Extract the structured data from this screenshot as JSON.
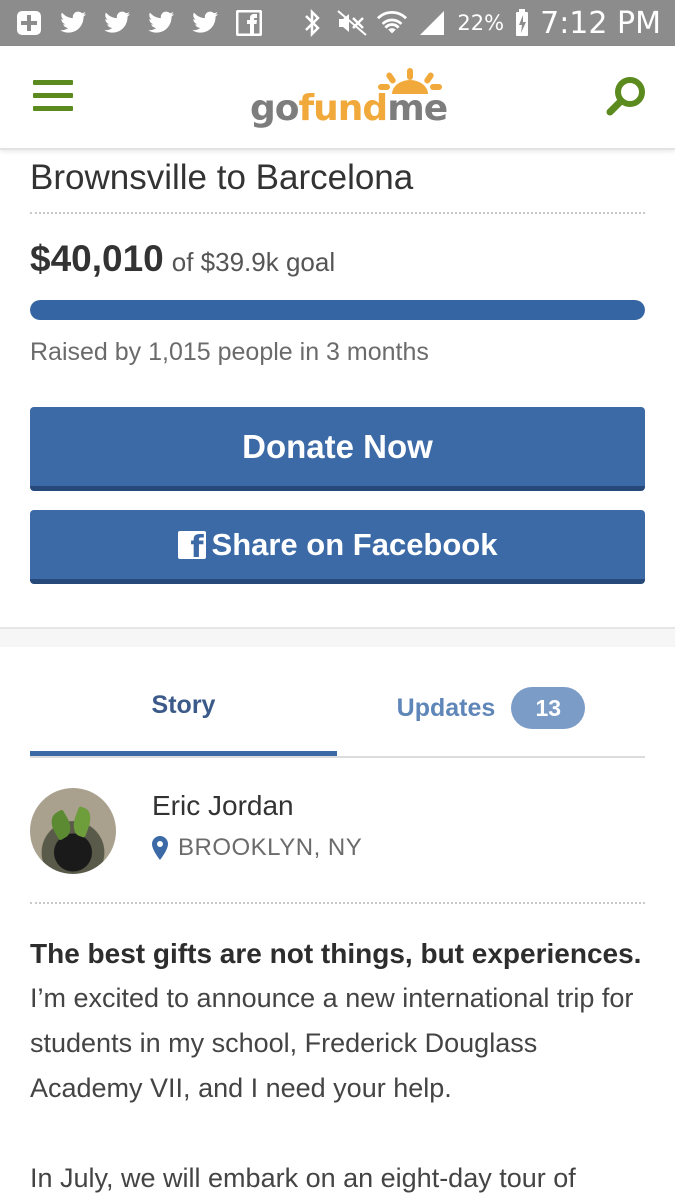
{
  "status_bar": {
    "battery": "22%",
    "time": "7:12 PM"
  },
  "header": {
    "logo": {
      "part1": "go",
      "part2": "fund",
      "part3": "me"
    }
  },
  "campaign": {
    "title": "Brownsville to Barcelona",
    "amount": "$40,010",
    "goal_text": "of $39.9k goal",
    "progress": 1.0,
    "raised_text": "Raised by 1,015 people in 3 months",
    "donate_label": "Donate Now",
    "share_label": "Share on Facebook"
  },
  "tabs": {
    "story": "Story",
    "updates": "Updates",
    "updates_count": "13"
  },
  "organizer": {
    "name": "Eric Jordan",
    "location": "BROOKLYN, NY"
  },
  "story": {
    "lead": "The best gifts are not things, but experiences.",
    "p1": "I’m excited to announce a new international trip for students in my school, Frederick Douglass Academy VII, and I need your help.",
    "p2": "In July, we will embark on an eight-day tour of"
  },
  "colors": {
    "brand_green": "#5b8a1e",
    "brand_orange": "#f2a93b",
    "button_blue": "#3b6aa6",
    "status_bar_gray": "#8c8c8c"
  }
}
